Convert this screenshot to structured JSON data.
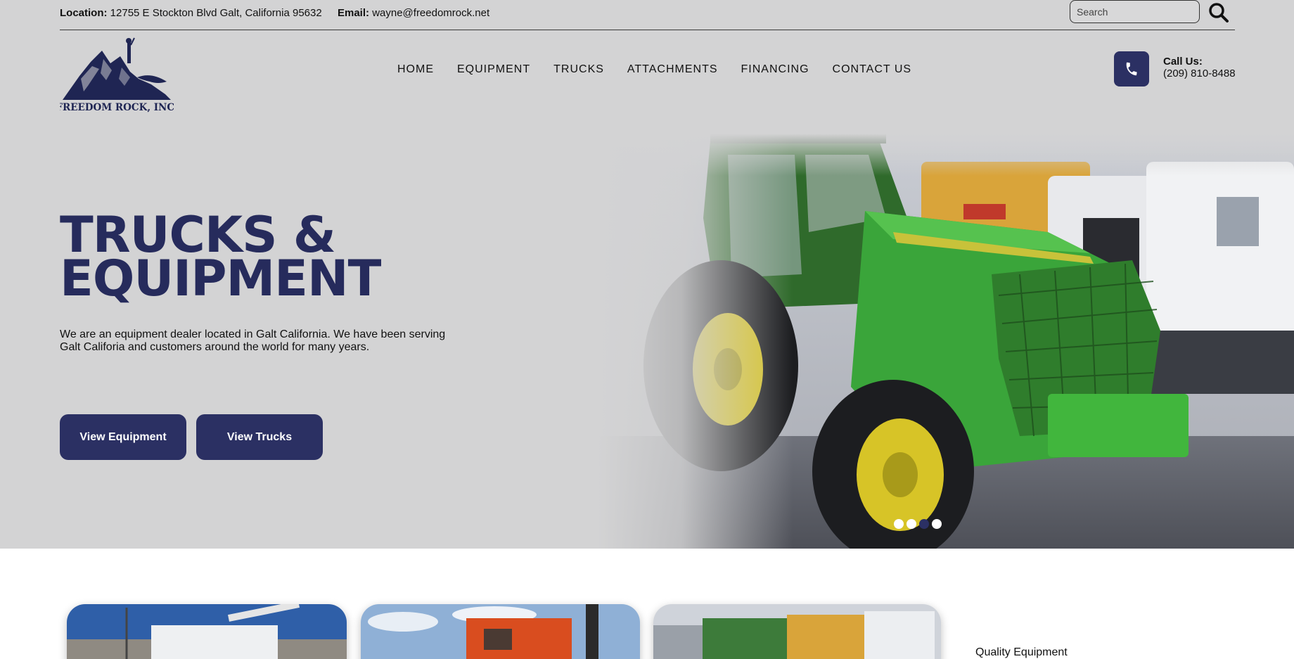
{
  "topbar": {
    "location_label": "Location:",
    "location_value": "12755 E Stockton Blvd Galt, California 95632",
    "email_label": "Email:",
    "email_value": "wayne@freedomrock.net",
    "search_placeholder": "Search"
  },
  "logo": {
    "text": "FREEDOM ROCK, INC."
  },
  "nav": {
    "items": [
      {
        "label": "HOME"
      },
      {
        "label": "EQUIPMENT"
      },
      {
        "label": "TRUCKS"
      },
      {
        "label": "ATTACHMENTS"
      },
      {
        "label": "FINANCING"
      },
      {
        "label": "CONTACT US"
      }
    ]
  },
  "call": {
    "label": "Call Us:",
    "phone": "(209) 810-8488"
  },
  "hero": {
    "title_line1": "TRUCKS &",
    "title_line2": "EQUIPMENT",
    "description": "We are an equipment dealer located in Galt California. We have been serving Galt Califoria and customers around the world for many years.",
    "buttons": [
      {
        "label": "View Equipment"
      },
      {
        "label": "View Trucks"
      }
    ],
    "slider_dots": 4,
    "active_dot": 3
  },
  "features": {
    "quality_label": "Quality Equipment"
  },
  "colors": {
    "brand_navy": "#2b3063",
    "title_navy": "#262b5c",
    "band_gray": "#d3d3d4"
  }
}
